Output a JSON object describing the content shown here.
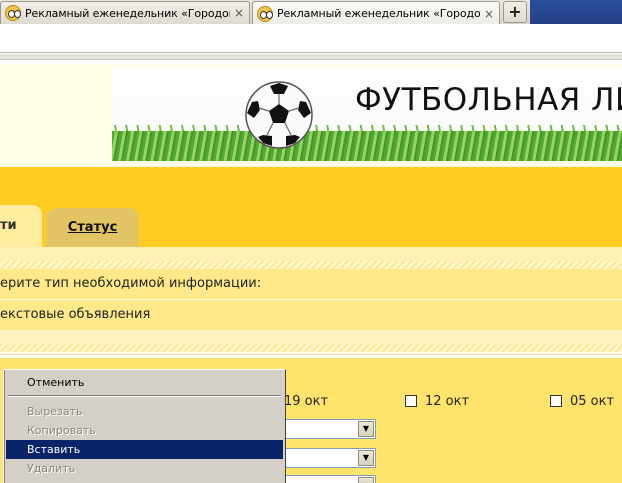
{
  "browser": {
    "tabs": [
      {
        "title": "Рекламный еженедельник «Городокъ...",
        "close": "×",
        "active": false
      },
      {
        "title": "Рекламный еженедельник «Городокъ...",
        "close": "×",
        "active": true
      }
    ],
    "new_tab_label": "+"
  },
  "banner": {
    "title": "ФУТБОЛЬНАЯ ЛИГ"
  },
  "tabs": {
    "current_label": "ти",
    "status_label": "Статус"
  },
  "info": {
    "choose_type_text": "ерите тип необходимой информации:",
    "option_text": "екстовые объявления"
  },
  "dates": [
    {
      "label": "19 окт"
    },
    {
      "label": "12 окт"
    },
    {
      "label": "05 окт"
    }
  ],
  "context_menu": {
    "items": [
      {
        "label": "Отменить",
        "state": "enabled"
      },
      {
        "label": "Вырезать",
        "state": "disabled"
      },
      {
        "label": "Копировать",
        "state": "disabled"
      },
      {
        "label": "Вставить",
        "state": "highlighted"
      },
      {
        "label": "Удалить",
        "state": "disabled"
      }
    ]
  },
  "colors": {
    "header_yellow": "#ffcc22",
    "menu_highlight": "#0a246a",
    "tab_status_bg": "#e2c464"
  }
}
